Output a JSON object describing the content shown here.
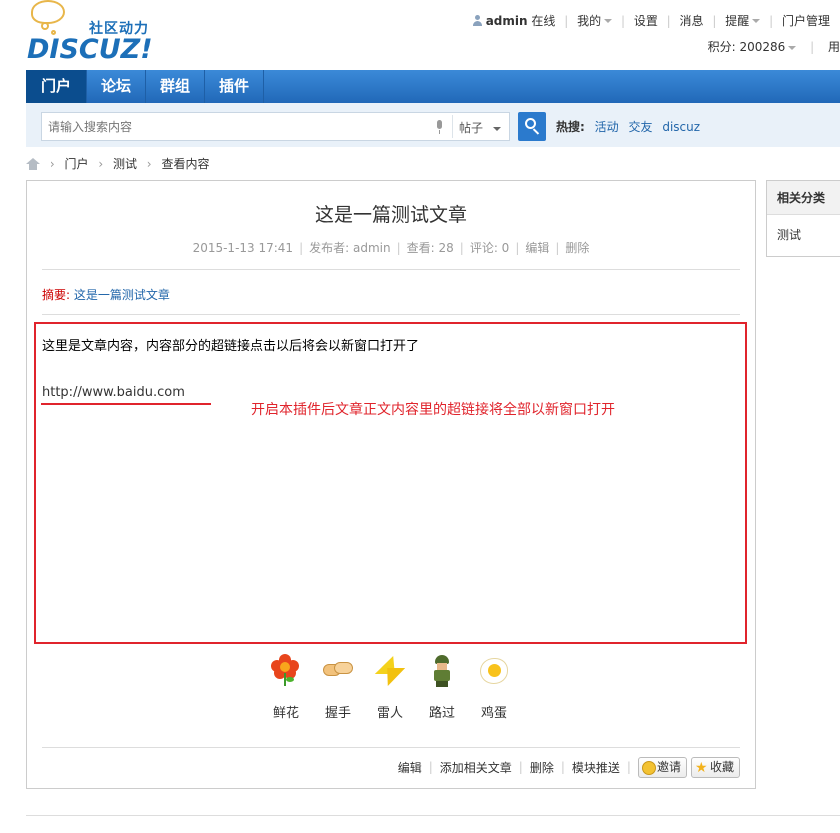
{
  "logo": {
    "cn": "社区动力",
    "en": "DISCUZ!"
  },
  "usernav": {
    "username": "admin",
    "status": "在线",
    "items": [
      "我的",
      "设置",
      "消息",
      "提醒",
      "门户管理"
    ],
    "points_label": "积分: 200286",
    "extra": "用"
  },
  "nav": {
    "items": [
      "门户",
      "论坛",
      "群组",
      "插件"
    ]
  },
  "search": {
    "placeholder": "请输入搜索内容",
    "type": "帖子",
    "hot_label": "热搜:",
    "hot_items": [
      "活动",
      "交友",
      "discuz"
    ]
  },
  "breadcrumb": {
    "items": [
      "门户",
      "测试",
      "查看内容"
    ]
  },
  "article": {
    "title": "这是一篇测试文章",
    "date": "2015-1-13 17:41",
    "author_label": "发布者: admin",
    "views_label": "查看: 28",
    "comments_label": "评论: 0",
    "edit": "编辑",
    "delete": "删除",
    "summary_label": "摘要:",
    "summary_text": "这是一篇测试文章",
    "body_text": "这里是文章内容，内容部分的超链接点击以后将会以新窗口打开了",
    "body_link": "http://www.baidu.com",
    "annotation": "开启本插件后文章正文内容里的超链接将全部以新窗口打开"
  },
  "reactions": [
    {
      "label": "鲜花",
      "icon": "flower-icon"
    },
    {
      "label": "握手",
      "icon": "handshake-icon"
    },
    {
      "label": "雷人",
      "icon": "lightning-icon"
    },
    {
      "label": "路过",
      "icon": "soldier-icon"
    },
    {
      "label": "鸡蛋",
      "icon": "egg-icon"
    }
  ],
  "actions": {
    "edit": "编辑",
    "add_related": "添加相关文章",
    "delete": "删除",
    "push": "模块推送",
    "invite": "邀请",
    "favorite": "收藏"
  },
  "sidebar": {
    "title": "相关分类",
    "items": [
      "测试"
    ]
  },
  "colors": {
    "nav_blue": "#2b7acd",
    "annotation_red": "#e0242c",
    "link_blue": "#2266aa"
  }
}
